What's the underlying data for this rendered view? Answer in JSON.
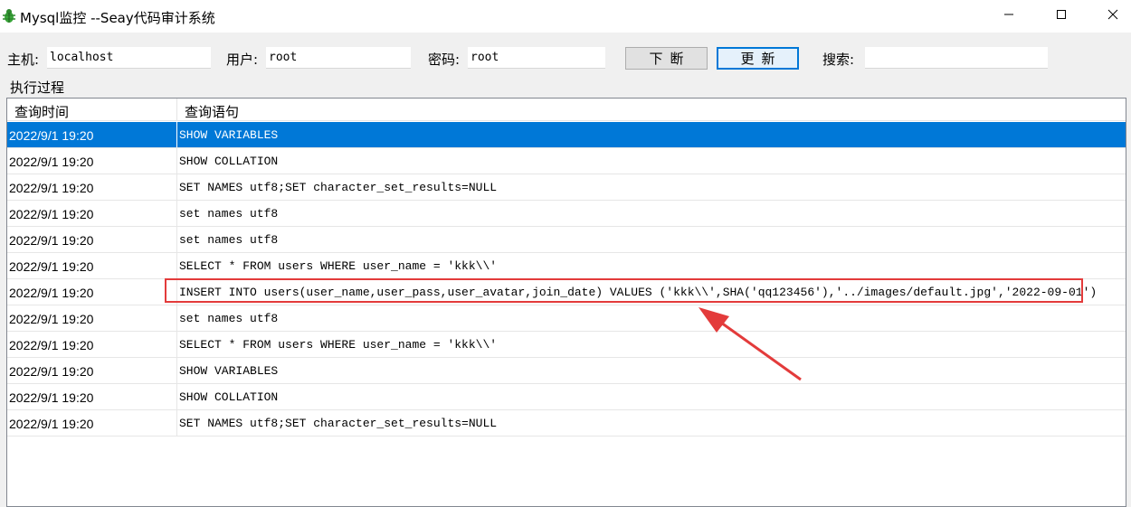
{
  "window": {
    "title": "Mysql监控 --Seay代码审计系统",
    "app_icon": "bug-icon",
    "controls": {
      "minimize": "minimize-icon",
      "maximize": "maximize-icon",
      "close": "close-icon"
    }
  },
  "toolbar": {
    "host_label": "主机:",
    "host_value": "localhost",
    "user_label": "用户:",
    "user_value": "root",
    "password_label": "密码:",
    "password_value": "root",
    "disconnect_label": "下断",
    "refresh_label": "更新",
    "search_label": "搜索:",
    "search_value": ""
  },
  "group_label": "执行过程",
  "table": {
    "columns": [
      "查询时间",
      "查询语句"
    ],
    "rows": [
      {
        "time": "2022/9/1 19:20",
        "sql": "SHOW VARIABLES"
      },
      {
        "time": "2022/9/1 19:20",
        "sql": "SHOW COLLATION"
      },
      {
        "time": "2022/9/1 19:20",
        "sql": "SET NAMES utf8;SET character_set_results=NULL"
      },
      {
        "time": "2022/9/1 19:20",
        "sql": "set names utf8"
      },
      {
        "time": "2022/9/1 19:20",
        "sql": "set names utf8"
      },
      {
        "time": "2022/9/1 19:20",
        "sql": "SELECT * FROM users WHERE user_name = 'kkk\\\\'"
      },
      {
        "time": "2022/9/1 19:20",
        "sql": "INSERT INTO users(user_name,user_pass,user_avatar,join_date) VALUES ('kkk\\\\',SHA('qq123456'),'../images/default.jpg','2022-09-01')"
      },
      {
        "time": "2022/9/1 19:20",
        "sql": "set names utf8"
      },
      {
        "time": "2022/9/1 19:20",
        "sql": "SELECT * FROM users WHERE user_name = 'kkk\\\\'"
      },
      {
        "time": "2022/9/1 19:20",
        "sql": "SHOW VARIABLES"
      },
      {
        "time": "2022/9/1 19:20",
        "sql": "SHOW COLLATION"
      },
      {
        "time": "2022/9/1 19:20",
        "sql": "SET NAMES utf8;SET character_set_results=NULL"
      }
    ],
    "selected_row": 0,
    "highlighted_row": 6
  },
  "colors": {
    "selection": "#0078d7",
    "annotation": "#e33b3b"
  }
}
